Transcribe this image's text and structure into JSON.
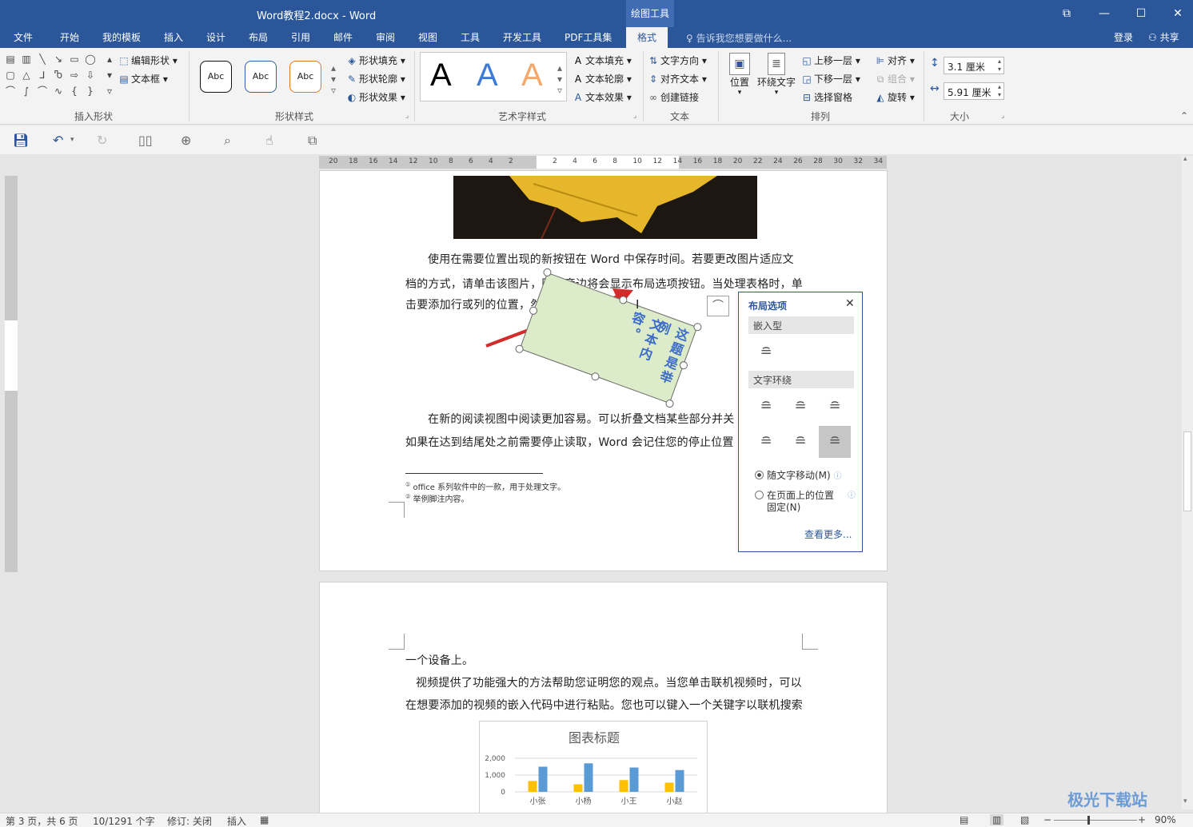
{
  "window": {
    "title": "Word教程2.docx - Word",
    "contextual_tab": "绘图工具"
  },
  "tabs": [
    "文件",
    "开始",
    "我的模板",
    "插入",
    "设计",
    "布局",
    "引用",
    "邮件",
    "审阅",
    "视图",
    "工具",
    "开发工具",
    "PDF工具集",
    "格式"
  ],
  "active_tab": "格式",
  "tell_me_placeholder": "告诉我您想要做什么...",
  "login_label": "登录",
  "share_label": "共享",
  "ribbon": {
    "groups": {
      "insert_shapes": "插入形状",
      "shape_styles": "形状样式",
      "wordart_styles": "艺术字样式",
      "text": "文本",
      "arrange": "排列",
      "size": "大小"
    },
    "edit_shape": "编辑形状",
    "text_box": "文本框",
    "style_sample": "Abc",
    "shape_fill": "形状填充",
    "shape_outline": "形状轮廓",
    "shape_effects": "形状效果",
    "wordart_letter": "A",
    "text_fill": "文本填充",
    "text_outline": "文本轮廓",
    "text_effects": "文本效果",
    "text_direction": "文字方向",
    "align_text": "对齐文本",
    "create_link": "创建链接",
    "position": "位置",
    "wrap_text": "环绕文字",
    "bring_forward": "上移一层",
    "send_backward": "下移一层",
    "selection_pane": "选择窗格",
    "align": "对齐",
    "group": "组合",
    "rotate": "旋转",
    "height_value": "3.1 厘米",
    "width_value": "5.91 厘米"
  },
  "ruler_numbers_left": [
    "20",
    "18",
    "16",
    "14",
    "12",
    "10",
    "8",
    "6",
    "4",
    "2"
  ],
  "ruler_numbers_right": [
    "2",
    "4",
    "6",
    "8",
    "10",
    "12",
    "14",
    "16",
    "18",
    "20",
    "22",
    "24",
    "26",
    "28",
    "30",
    "32",
    "34"
  ],
  "document": {
    "para1_line1": "使用在需要位置出现的新按钮在 Word 中保存时间。若要更改图片适应文",
    "para1_line2": "档的方式，请单击该图片，图片旁边将会显示布局选项按钮。当处理表格时，单",
    "para1_line3": "击要添加行或列的位置，然后单击加号。",
    "textbox_col1": "这题是举例",
    "textbox_col2": "文本内容。",
    "para2_line1": "在新的阅读视图中阅读更加容易。可以折叠文档某些部分并关",
    "para2_line2": "如果在达到结尾处之前需要停止读取，Word 会记住您的停止位置",
    "footnote1": "office 系列软件中的一款，用于处理文字。",
    "footnote2": "举例脚注内容。",
    "page2_line1": "一个设备上。",
    "page2_line2": "视频提供了功能强大的方法帮助您证明您的观点。当您单击联机视频时，可以",
    "page2_line3": "在想要添加的视频的嵌入代码中进行粘贴。您也可以键入一个关键字以联机搜索"
  },
  "layout_options": {
    "title": "布局选项",
    "inline_section": "嵌入型",
    "wrap_section": "文字环绕",
    "move_with_text": "随文字移动(M)",
    "fix_on_page_line1": "在页面上的位置",
    "fix_on_page_line2": "固定(N)",
    "see_more": "查看更多..."
  },
  "chart_data": {
    "type": "bar",
    "title": "图表标题",
    "categories": [
      "小张",
      "小杨",
      "小王",
      "小赵"
    ],
    "series": [
      {
        "values": [
          650,
          450,
          700,
          550
        ],
        "color": "#ffc000"
      },
      {
        "values": [
          1500,
          1700,
          1450,
          1300
        ],
        "color": "#5b9bd5"
      }
    ],
    "ylim": [
      0,
      2000
    ],
    "yticks": [
      "0",
      "1,000",
      "2,000"
    ]
  },
  "status": {
    "page": "第 3 页，共 6 页",
    "words": "10/1291 个字",
    "track": "修订: 关闭",
    "insert": "插入",
    "zoom": "90%"
  },
  "watermark": "极光下载站"
}
